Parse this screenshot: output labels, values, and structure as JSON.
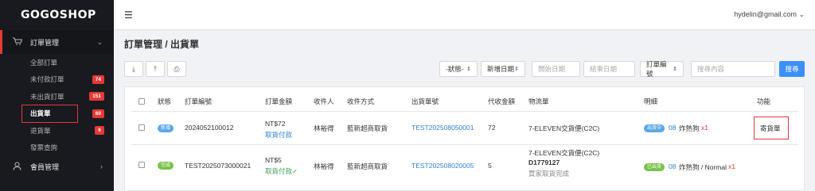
{
  "sidebar": {
    "logo": "GOGOSHOP",
    "group_orders": "訂單管理",
    "items": [
      {
        "label": "全部訂單"
      },
      {
        "label": "未付款訂單",
        "badge": "74"
      },
      {
        "label": "未出貨訂單",
        "badge": "151"
      },
      {
        "label": "出貨單",
        "badge": "60"
      },
      {
        "label": "退貨單",
        "badge": "6"
      },
      {
        "label": "發票查詢"
      }
    ],
    "group_members": "會員管理"
  },
  "topbar": {
    "user": "hydelin@gmail.com ⌄"
  },
  "page": {
    "title": "訂單管理 / 出貨單"
  },
  "filters": {
    "status": "-狀態-",
    "date_type": "新增日期",
    "start_placeholder": "開始日期",
    "end_placeholder": "結束日期",
    "field": "訂單編號",
    "keyword_placeholder": "搜尋內容",
    "search": "搜尋"
  },
  "table": {
    "headers": [
      "狀態",
      "訂單編號",
      "訂單金額",
      "收件人",
      "收件方式",
      "出貨單號",
      "代收金額",
      "物流單",
      "明細",
      "功能"
    ],
    "rows": [
      {
        "status": "新增",
        "order_no": "2024052100012",
        "amount": "NT$72",
        "pay_status": "取貨付款",
        "recipient": "林裕得",
        "method": "藍新超商取貨",
        "ship_no": "TEST202508050001",
        "cod": "72",
        "logistics": "7-ELEVEN交貨便(C2C)",
        "detail_tag": "出貨中",
        "detail_code": "08",
        "detail_item": "炸熱狗",
        "detail_qty": "x1",
        "action": "寄貨單"
      },
      {
        "status": "完成",
        "order_no": "TEST2025073000021",
        "amount": "NT$5",
        "pay_status": "取貨付款✓",
        "recipient": "林裕得",
        "method": "藍新超商取貨",
        "ship_no": "TEST202508020005",
        "cod": "5",
        "logistics": "7-ELEVEN交貨便(C2C)",
        "logistics_no": "D1779127",
        "logistics_status": "買家取貨完成",
        "detail_tag": "已出貨",
        "detail_code": "08",
        "detail_item": "炸熱狗 / Normal",
        "detail_qty": "x1"
      }
    ]
  },
  "colors": {
    "accent": "#3e8ef7",
    "danger": "#e53935",
    "sidebar_bg": "#181a1f"
  },
  "icons": [
    "menu-icon",
    "cart-icon",
    "chevron-down-icon",
    "user-icon",
    "chevron-right-icon",
    "download-icon",
    "upload-icon",
    "print-icon"
  ]
}
